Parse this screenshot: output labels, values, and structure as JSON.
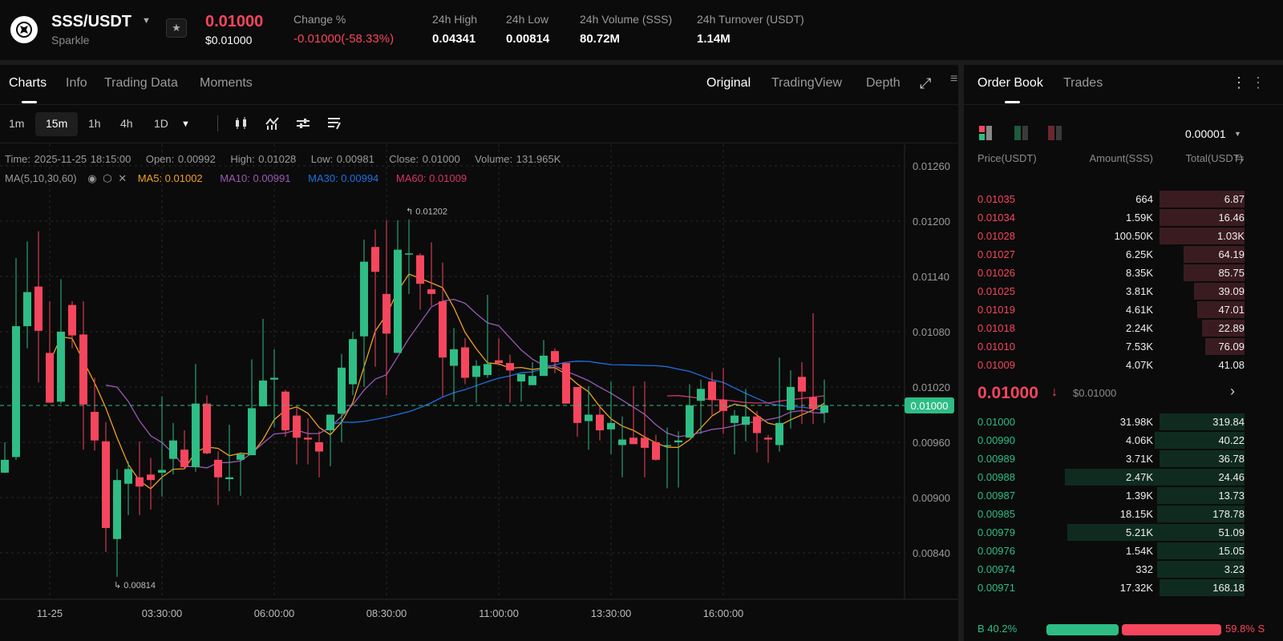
{
  "header": {
    "pair": "SSS/USDT",
    "name": "Sparkle",
    "price": "0.01000",
    "price_usd": "$0.01000",
    "stats": [
      {
        "label": "Change %",
        "value": "-0.01000(-58.33%)",
        "color": "#f6465d"
      },
      {
        "label": "24h High",
        "value": "0.04341"
      },
      {
        "label": "24h Low",
        "value": "0.00814"
      },
      {
        "label": "24h Volume (SSS)",
        "value": "80.72M"
      },
      {
        "label": "24h Turnover (USDT)",
        "value": "1.14M"
      }
    ]
  },
  "tabs": {
    "left": [
      "Charts",
      "Info",
      "Trading Data",
      "Moments"
    ],
    "right": [
      "Original",
      "TradingView",
      "Depth"
    ]
  },
  "toolbar": {
    "intervals": [
      "1m",
      "15m",
      "1h",
      "4h",
      "1D"
    ],
    "active": "15m"
  },
  "info": {
    "time": "Time: 2025-11-25 18:15:00",
    "open": "Open: 0.00992",
    "high": "High: 0.01028",
    "low": "Low: 0.00981",
    "close": "Close: 0.01000",
    "volume": "Volume: 131.965K"
  },
  "ma": {
    "label": "MA(5,10,30,60)",
    "ma5": "MA5: 0.01002",
    "ma10": "MA10: 0.00991",
    "ma30": "MA30: 0.00994",
    "ma60": "MA60: 0.01009"
  },
  "colors": {
    "up": "#2ebd85",
    "down": "#f6465d",
    "ma5": "#f0a020",
    "ma10": "#9b59b6",
    "ma30": "#1e6fe0",
    "ma60": "#d6336c"
  },
  "chart_data": {
    "type": "candlestick",
    "interval": "15m",
    "x_ticks": [
      {
        "index": 4,
        "label": "11-25"
      },
      {
        "index": 14,
        "label": "03:30:00"
      },
      {
        "index": 24,
        "label": "06:00:00"
      },
      {
        "index": 34,
        "label": "08:30:00"
      },
      {
        "index": 44,
        "label": "11:00:00"
      },
      {
        "index": 54,
        "label": "13:30:00"
      },
      {
        "index": 64,
        "label": "16:00:00"
      }
    ],
    "y_ticks": [
      "0.01260",
      "0.01200",
      "0.01140",
      "0.01080",
      "0.01020",
      "0.00960",
      "0.00900",
      "0.00840"
    ],
    "ylim": [
      0.0081,
      0.0128
    ],
    "current_price": "0.01000",
    "max_label": "0.01202",
    "min_label": "0.00814",
    "ohlc": [
      [
        0.00927,
        0.0096,
        0.00927,
        0.00941
      ],
      [
        0.00944,
        0.0116,
        0.00941,
        0.01086
      ],
      [
        0.01086,
        0.01178,
        0.01062,
        0.01123
      ],
      [
        0.01129,
        0.01189,
        0.01025,
        0.01081
      ],
      [
        0.01057,
        0.01113,
        0.01003,
        0.01003
      ],
      [
        0.01004,
        0.01137,
        0.01002,
        0.0108
      ],
      [
        0.01109,
        0.01113,
        0.01062,
        0.01076
      ],
      [
        0.01077,
        0.01113,
        0.00952,
        0.01001
      ],
      [
        0.00993,
        0.0103,
        0.00951,
        0.00962
      ],
      [
        0.00961,
        0.00982,
        0.00841,
        0.00867
      ],
      [
        0.00855,
        0.00931,
        0.00814,
        0.00919
      ],
      [
        0.00915,
        0.00939,
        0.00881,
        0.00931
      ],
      [
        0.00922,
        0.00961,
        0.00881,
        0.00912
      ],
      [
        0.00925,
        0.00943,
        0.00887,
        0.00919
      ],
      [
        0.00927,
        0.0101,
        0.00901,
        0.0093
      ],
      [
        0.00942,
        0.00981,
        0.00925,
        0.00962
      ],
      [
        0.00952,
        0.00973,
        0.00931,
        0.00933
      ],
      [
        0.00933,
        0.01045,
        0.00928,
        0.01002
      ],
      [
        0.01002,
        0.01011,
        0.00947,
        0.00948
      ],
      [
        0.00941,
        0.0095,
        0.00892,
        0.00922
      ],
      [
        0.0092,
        0.00979,
        0.00907,
        0.00922
      ],
      [
        0.00941,
        0.00949,
        0.00902,
        0.00947
      ],
      [
        0.00946,
        0.0105,
        0.00946,
        0.00997
      ],
      [
        0.00999,
        0.01094,
        0.00999,
        0.01027
      ],
      [
        0.01028,
        0.01061,
        0.00976,
        0.0103
      ],
      [
        0.01015,
        0.01017,
        0.00966,
        0.00973
      ],
      [
        0.00989,
        0.00998,
        0.00936,
        0.00965
      ],
      [
        0.00965,
        0.00986,
        0.00936,
        0.00963
      ],
      [
        0.0096,
        0.00972,
        0.00922,
        0.0095
      ],
      [
        0.00973,
        0.0099,
        0.00934,
        0.0099
      ],
      [
        0.00991,
        0.01056,
        0.0096,
        0.01041
      ],
      [
        0.01023,
        0.0108,
        0.01011,
        0.01072
      ],
      [
        0.01075,
        0.0118,
        0.0102,
        0.01156
      ],
      [
        0.01172,
        0.01191,
        0.01042,
        0.01145
      ],
      [
        0.01121,
        0.01201,
        0.01011,
        0.01078
      ],
      [
        0.01057,
        0.01201,
        0.01057,
        0.01169
      ],
      [
        0.01164,
        0.01202,
        0.01121,
        0.01165
      ],
      [
        0.01163,
        0.01165,
        0.01104,
        0.01132
      ],
      [
        0.01126,
        0.01177,
        0.01108,
        0.01121
      ],
      [
        0.01113,
        0.01155,
        0.0101,
        0.01052
      ],
      [
        0.01043,
        0.01084,
        0.01004,
        0.01061
      ],
      [
        0.01063,
        0.01073,
        0.01023,
        0.0103
      ],
      [
        0.01031,
        0.01049,
        0.01003,
        0.01043
      ],
      [
        0.01033,
        0.0112,
        0.0103,
        0.01045
      ],
      [
        0.01049,
        0.01073,
        0.01043,
        0.01046
      ],
      [
        0.01046,
        0.01055,
        0.01003,
        0.01038
      ],
      [
        0.01026,
        0.01034,
        0.01004,
        0.01034
      ],
      [
        0.01022,
        0.01047,
        0.01022,
        0.01032
      ],
      [
        0.01032,
        0.01071,
        0.01032,
        0.01054
      ],
      [
        0.01059,
        0.01062,
        0.01035,
        0.01047
      ],
      [
        0.01046,
        0.01046,
        0.01002,
        0.01002
      ],
      [
        0.0102,
        0.0102,
        0.00966,
        0.00981
      ],
      [
        0.00983,
        0.01021,
        0.00952,
        0.0099
      ],
      [
        0.0099,
        0.01001,
        0.00962,
        0.00973
      ],
      [
        0.00974,
        0.01026,
        0.00947,
        0.00981
      ],
      [
        0.00957,
        0.00988,
        0.00922,
        0.00963
      ],
      [
        0.00965,
        0.01021,
        0.00958,
        0.00958
      ],
      [
        0.00965,
        0.01026,
        0.00922,
        0.00954
      ],
      [
        0.0096,
        0.00968,
        0.0094,
        0.00941
      ],
      [
        0.00956,
        0.00976,
        0.0091,
        0.00957
      ],
      [
        0.0096,
        0.00972,
        0.00911,
        0.00962
      ],
      [
        0.00965,
        0.01023,
        0.00965,
        0.01
      ],
      [
        0.01005,
        0.01028,
        0.00969,
        0.01018
      ],
      [
        0.01026,
        0.01036,
        0.00988,
        0.01006
      ],
      [
        0.01006,
        0.01041,
        0.00969,
        0.00994
      ],
      [
        0.00981,
        0.00995,
        0.00947,
        0.00989
      ],
      [
        0.00979,
        0.01018,
        0.00961,
        0.00988
      ],
      [
        0.00988,
        0.00994,
        0.00949,
        0.0097
      ],
      [
        0.00965,
        0.00968,
        0.00938,
        0.00963
      ],
      [
        0.00957,
        0.01052,
        0.0095,
        0.00981
      ],
      [
        0.00995,
        0.01038,
        0.00975,
        0.0102
      ],
      [
        0.01031,
        0.01047,
        0.0098,
        0.01015
      ],
      [
        0.01009,
        0.011,
        0.0098,
        0.00996
      ],
      [
        0.00992,
        0.01028,
        0.00981,
        0.01
      ]
    ]
  },
  "orderbook": {
    "tabs": [
      "Order Book",
      "Trades"
    ],
    "precision": "0.00001",
    "headers": {
      "price": "Price(USDT)",
      "amount": "Amount(SSS)",
      "total": "Total(USDT)"
    },
    "asks": [
      {
        "price": "0.01035",
        "amount": "664",
        "total": "6.87",
        "depth": 0.32
      },
      {
        "price": "0.01034",
        "amount": "1.59K",
        "total": "16.46",
        "depth": 0.32
      },
      {
        "price": "0.01028",
        "amount": "100.50K",
        "total": "1.03K",
        "depth": 0.32
      },
      {
        "price": "0.01027",
        "amount": "6.25K",
        "total": "64.19",
        "depth": 0.23
      },
      {
        "price": "0.01026",
        "amount": "8.35K",
        "total": "85.75",
        "depth": 0.23
      },
      {
        "price": "0.01025",
        "amount": "3.81K",
        "total": "39.09",
        "depth": 0.19
      },
      {
        "price": "0.01019",
        "amount": "4.61K",
        "total": "47.01",
        "depth": 0.18
      },
      {
        "price": "0.01018",
        "amount": "2.24K",
        "total": "22.89",
        "depth": 0.16
      },
      {
        "price": "0.01010",
        "amount": "7.53K",
        "total": "76.09",
        "depth": 0.15
      },
      {
        "price": "0.01009",
        "amount": "4.07K",
        "total": "41.08",
        "depth": 0.0
      }
    ],
    "mid": {
      "price": "0.01000",
      "usd": "$0.01000"
    },
    "bids": [
      {
        "price": "0.01000",
        "amount": "31.98K",
        "total": "319.84",
        "depth": 0.32
      },
      {
        "price": "0.00990",
        "amount": "4.06K",
        "total": "40.22",
        "depth": 0.34
      },
      {
        "price": "0.00989",
        "amount": "3.71K",
        "total": "36.78",
        "depth": 0.32
      },
      {
        "price": "0.00988",
        "amount": "2.47K",
        "total": "24.46",
        "depth": 0.68
      },
      {
        "price": "0.00987",
        "amount": "1.39K",
        "total": "13.73",
        "depth": 0.33
      },
      {
        "price": "0.00985",
        "amount": "18.15K",
        "total": "178.78",
        "depth": 0.33
      },
      {
        "price": "0.00979",
        "amount": "5.21K",
        "total": "51.09",
        "depth": 0.67
      },
      {
        "price": "0.00976",
        "amount": "1.54K",
        "total": "15.05",
        "depth": 0.33
      },
      {
        "price": "0.00974",
        "amount": "332",
        "total": "3.23",
        "depth": 0.33
      },
      {
        "price": "0.00971",
        "amount": "17.32K",
        "total": "168.18",
        "depth": 0.32
      }
    ],
    "ratio": {
      "buy": "B 40.2%",
      "sell": "59.8% S",
      "buy_fraction": 0.402
    }
  }
}
